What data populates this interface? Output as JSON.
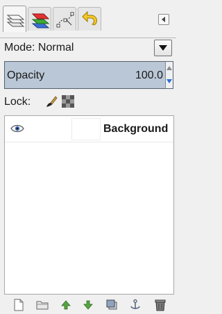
{
  "tabs": [
    {
      "name": "layers-tab",
      "icon": "layers-icon"
    },
    {
      "name": "channels-tab",
      "icon": "channels-icon"
    },
    {
      "name": "paths-tab",
      "icon": "paths-icon"
    },
    {
      "name": "undo-history-tab",
      "icon": "undo-history-icon"
    }
  ],
  "mode": {
    "label": "Mode: Normal"
  },
  "opacity": {
    "label": "Opacity",
    "value": "100.0"
  },
  "lock": {
    "label": "Lock:"
  },
  "layers": [
    {
      "name": "Background",
      "visible": true
    }
  ],
  "bottom_buttons": [
    "new-layer-icon",
    "new-layer-group-icon",
    "raise-layer-icon",
    "lower-layer-icon",
    "duplicate-layer-icon",
    "anchor-layer-icon",
    "delete-layer-icon"
  ],
  "colors": {
    "selection": "#b9c7d6",
    "accent_green": "#55a640"
  }
}
